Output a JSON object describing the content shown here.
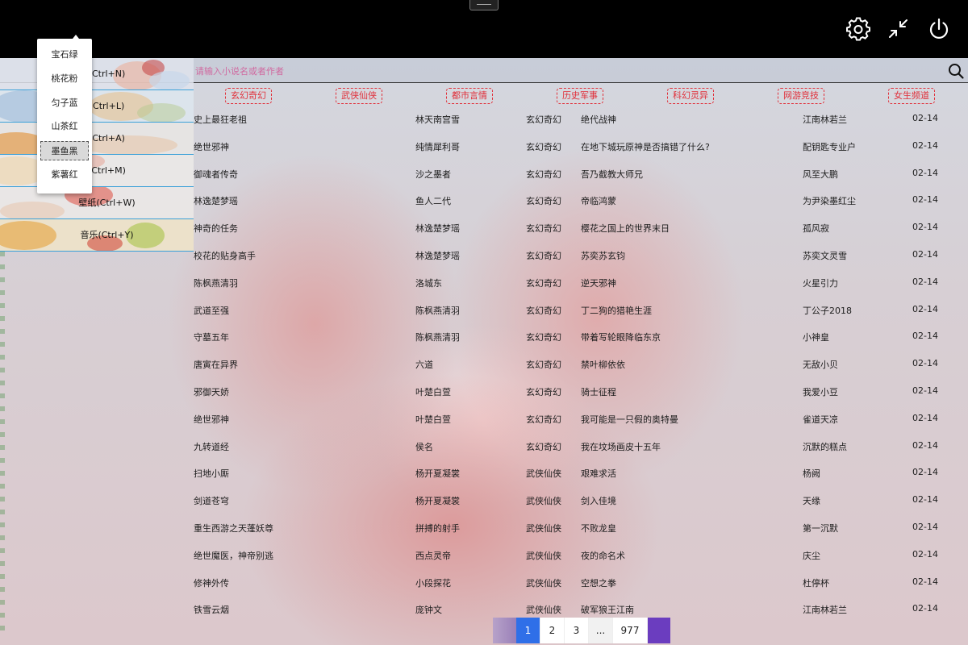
{
  "window": {
    "icons": [
      "gear-icon",
      "collapse-icon",
      "power-icon"
    ]
  },
  "search": {
    "placeholder": "请输入小说名或者作者"
  },
  "categories": [
    "玄幻奇幻",
    "武侠仙侠",
    "都市言情",
    "历史军事",
    "科幻灵异",
    "网游竞技",
    "女生频道"
  ],
  "side_menu": [
    {
      "label": "(Ctrl+N)"
    },
    {
      "label": "(Ctrl+L)"
    },
    {
      "label": "(Ctrl+A)"
    },
    {
      "label": "(Ctrl+M)"
    },
    {
      "label": "壁纸(Ctrl+W)"
    },
    {
      "label": "音乐(Ctrl+Y)"
    }
  ],
  "theme_menu": {
    "items": [
      "宝石绿",
      "桃花粉",
      "匀子蓝",
      "山茶红",
      "墨鱼黑",
      "紫薯红"
    ],
    "selected": "墨鱼黑"
  },
  "books": [
    {
      "name": "史上最狂老祖",
      "author": "林天南宫雪",
      "category": "玄幻奇幻",
      "latest": "绝代战神",
      "updater": "江南林若兰",
      "date": "02-14"
    },
    {
      "name": "绝世邪神",
      "author": "纯情犀利哥",
      "category": "玄幻奇幻",
      "latest": "在地下城玩原神是否搞错了什么?",
      "updater": "配钥匙专业户",
      "date": "02-14"
    },
    {
      "name": "御魂者传奇",
      "author": "沙之墨者",
      "category": "玄幻奇幻",
      "latest": "吾乃截教大师兄",
      "updater": "风至大鹏",
      "date": "02-14"
    },
    {
      "name": "林逸楚梦瑶",
      "author": "鱼人二代",
      "category": "玄幻奇幻",
      "latest": "帝临鸿蒙",
      "updater": "为尹染墨红尘",
      "date": "02-14"
    },
    {
      "name": "神奇的任务",
      "author": "林逸楚梦瑶",
      "category": "玄幻奇幻",
      "latest": "樱花之国上的世界末日",
      "updater": "孤风寂",
      "date": "02-14"
    },
    {
      "name": "校花的贴身高手",
      "author": "林逸楚梦瑶",
      "category": "玄幻奇幻",
      "latest": "苏奕苏玄钧",
      "updater": "苏奕文灵雪",
      "date": "02-14"
    },
    {
      "name": "陈枫燕清羽",
      "author": "洛城东",
      "category": "玄幻奇幻",
      "latest": "逆天邪神",
      "updater": "火星引力",
      "date": "02-14"
    },
    {
      "name": "武道至强",
      "author": "陈枫燕清羽",
      "category": "玄幻奇幻",
      "latest": "丁二狗的猎艳生涯",
      "updater": "丁公子2018",
      "date": "02-14"
    },
    {
      "name": "守墓五年",
      "author": "陈枫燕清羽",
      "category": "玄幻奇幻",
      "latest": "带着写轮眼降临东京",
      "updater": "小神皇",
      "date": "02-14"
    },
    {
      "name": "唐寅在异界",
      "author": "六道",
      "category": "玄幻奇幻",
      "latest": "禁叶柳依依",
      "updater": "无敌小贝",
      "date": "02-14"
    },
    {
      "name": "邪御天娇",
      "author": "叶楚白萱",
      "category": "玄幻奇幻",
      "latest": "骑士征程",
      "updater": "我爱小豆",
      "date": "02-14"
    },
    {
      "name": "绝世邪神",
      "author": "叶楚白萱",
      "category": "玄幻奇幻",
      "latest": "我可能是一只假的奥特曼",
      "updater": "雀道天凉",
      "date": "02-14"
    },
    {
      "name": "九转道经",
      "author": "侯名",
      "category": "玄幻奇幻",
      "latest": "我在坟场画皮十五年",
      "updater": "沉默的糕点",
      "date": "02-14"
    },
    {
      "name": "扫地小厮",
      "author": "杨开夏凝裳",
      "category": "武侠仙侠",
      "latest": "艰难求活",
      "updater": "杨阙",
      "date": "02-14"
    },
    {
      "name": "剑道苍穹",
      "author": "杨开夏凝裳",
      "category": "武侠仙侠",
      "latest": "剑入佳境",
      "updater": "天缘",
      "date": "02-14"
    },
    {
      "name": "重生西游之天蓬妖尊",
      "author": "拼搏的射手",
      "category": "武侠仙侠",
      "latest": "不败龙皇",
      "updater": "第一沉默",
      "date": "02-14"
    },
    {
      "name": "绝世魔医，神帝别逃",
      "author": "西点灵帝",
      "category": "武侠仙侠",
      "latest": "夜的命名术",
      "updater": "庆尘",
      "date": "02-14"
    },
    {
      "name": "修神外传",
      "author": "小段探花",
      "category": "武侠仙侠",
      "latest": "空想之拳",
      "updater": "杜停杯",
      "date": "02-14"
    },
    {
      "name": "铁雪云烟",
      "author": "庞钟文",
      "category": "武侠仙侠",
      "latest": "破军狼王江南",
      "updater": "江南林若兰",
      "date": "02-14"
    }
  ],
  "pagination": {
    "pages": [
      "1",
      "2",
      "3"
    ],
    "dots": "...",
    "last": "977",
    "current": "1"
  }
}
